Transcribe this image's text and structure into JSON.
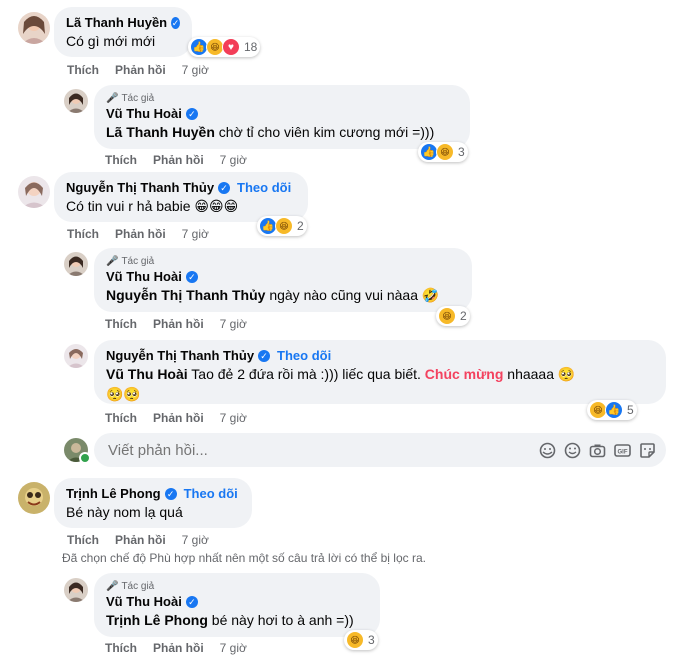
{
  "comments": [
    {
      "name": "Lã Thanh Huyền",
      "text": "Có gì mới mới",
      "reactions_count": "18",
      "like": "Thích",
      "reply": "Phản hồi",
      "time": "7 giờ"
    },
    {
      "author_label": "Tác giả",
      "name": "Vũ Thu Hoài",
      "mention": "Lã Thanh Huyền",
      "text": " chờ tỉ cho viên kim cương mới =)))",
      "reactions_count": "3",
      "like": "Thích",
      "reply": "Phản hồi",
      "time": "7 giờ"
    },
    {
      "name": "Nguyễn Thị Thanh Thủy",
      "follow": "Theo dõi",
      "text": "Có tin vui r hả babie 😁😁😁",
      "reactions_count": "2",
      "like": "Thích",
      "reply": "Phản hồi",
      "time": "7 giờ"
    },
    {
      "author_label": "Tác giả",
      "name": "Vũ Thu Hoài",
      "mention": "Nguyễn Thị Thanh Thủy",
      "text": " ngày nào cũng vui nàaa 🤣",
      "reactions_count": "2",
      "like": "Thích",
      "reply": "Phản hồi",
      "time": "7 giờ"
    },
    {
      "name": "Nguyễn Thị Thanh Thủy",
      "follow": "Theo dõi",
      "mention": "Vũ Thu Hoài",
      "text_a": " Tao đẻ 2 đứa rồi mà :))) liếc qua biết. ",
      "highlight": "Chúc mừng",
      "text_b": " nhaaaa 🥺",
      "text_line2": "🥺🥺",
      "reactions_count": "5",
      "like": "Thích",
      "reply": "Phản hồi",
      "time": "7 giờ"
    },
    {
      "name": "Trịnh Lê Phong",
      "follow": "Theo dõi",
      "text": "Bé này nom lạ quá",
      "like": "Thích",
      "reply": "Phản hồi",
      "time": "7 giờ"
    },
    {
      "author_label": "Tác giả",
      "name": "Vũ Thu Hoài",
      "mention": "Trịnh Lê Phong",
      "text": " bé này hơi to à anh =))",
      "reactions_count": "3",
      "like": "Thích",
      "reply": "Phản hồi",
      "time": "7 giờ"
    }
  ],
  "reply_box": {
    "placeholder": "Viết phản hồi..."
  },
  "filter_notice": "Đã chọn chế độ Phù hợp nhất nên một số câu trả lời có thể bị lọc ra.",
  "colors": {
    "accent": "#1877f2",
    "bubble": "#f0f2f5",
    "meta": "#65676b",
    "highlight": "#f3425f"
  }
}
